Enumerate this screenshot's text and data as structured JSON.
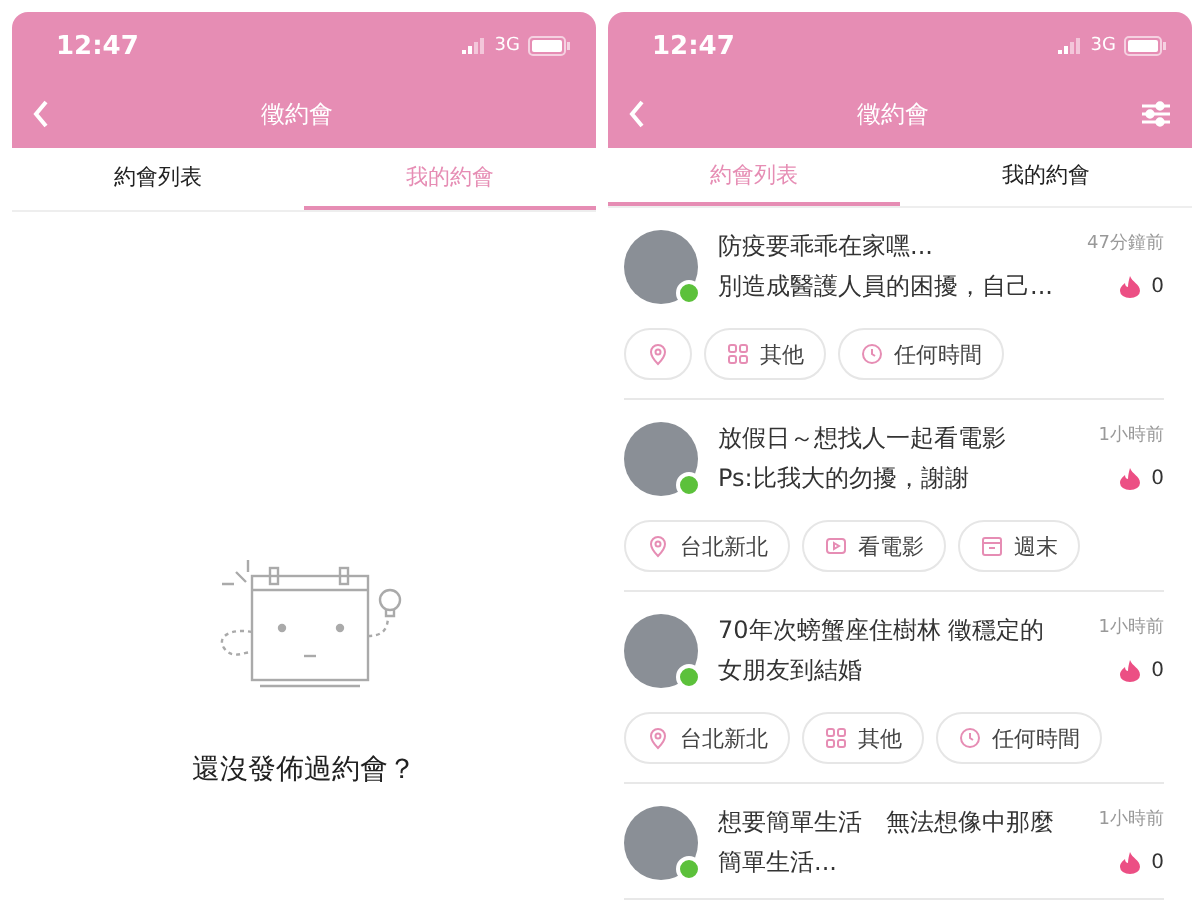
{
  "screens": [
    {
      "status": {
        "time": "12:47",
        "network": "3G"
      },
      "title": "徵約會",
      "show_filter": false,
      "tabs": [
        {
          "label": "約會列表",
          "selected": false
        },
        {
          "label": "我的約會",
          "selected": true
        }
      ],
      "content": {
        "kind": "empty",
        "message": "還沒發佈過約會？"
      }
    },
    {
      "status": {
        "time": "12:47",
        "network": "3G"
      },
      "title": "徵約會",
      "show_filter": true,
      "tabs": [
        {
          "label": "約會列表",
          "selected": true
        },
        {
          "label": "我的約會",
          "selected": false
        }
      ],
      "content": {
        "kind": "list",
        "posts": [
          {
            "title": "防疫要乖乖在家嘿...",
            "body": "別造成醫護人員的困擾，自己...",
            "time": "47分鐘前",
            "likes": "0",
            "online": true,
            "tags": [
              {
                "kind": "place"
              },
              {
                "kind": "category",
                "label": "其他"
              },
              {
                "kind": "time",
                "label": "任何時間"
              }
            ]
          },
          {
            "title": "放假日～想找人一起看電影",
            "body": "Ps:比我大的勿擾，謝謝",
            "time": "1小時前",
            "likes": "0",
            "online": true,
            "tags": [
              {
                "kind": "place",
                "label": "台北新北"
              },
              {
                "kind": "movie",
                "label": "看電影"
              },
              {
                "kind": "weekend",
                "label": "週末"
              }
            ]
          },
          {
            "title": "70年次螃蟹座住樹林 徵穩定的",
            "body": "女朋友到結婚",
            "time": "1小時前",
            "likes": "0",
            "online": true,
            "tags": [
              {
                "kind": "place",
                "label": "台北新北"
              },
              {
                "kind": "category",
                "label": "其他"
              },
              {
                "kind": "time",
                "label": "任何時間"
              }
            ]
          },
          {
            "title": "想要簡單生活　無法想像中那麼",
            "body": "簡單生活...",
            "time": "1小時前",
            "likes": "0",
            "online": true
          }
        ]
      }
    }
  ]
}
